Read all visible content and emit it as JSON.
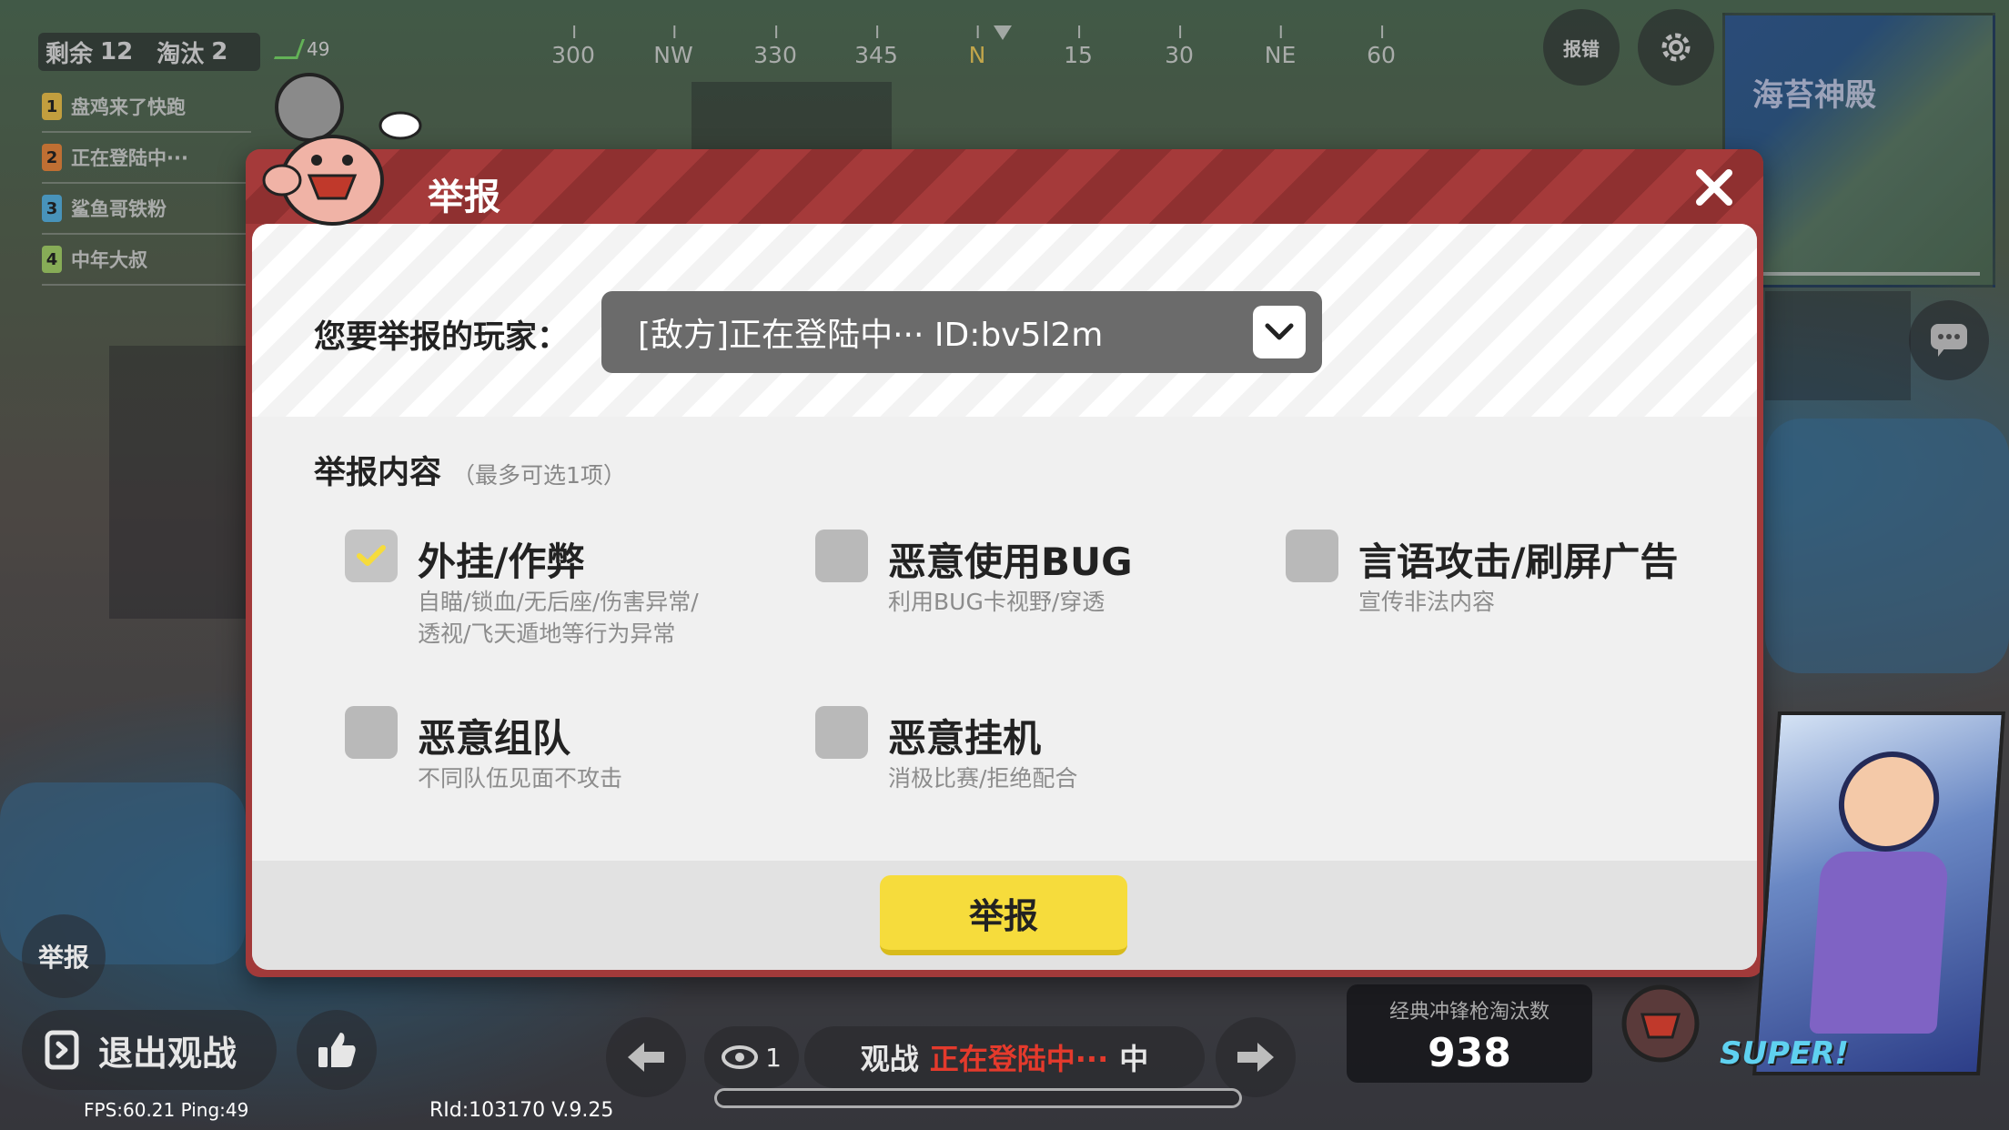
{
  "hud": {
    "remaining_label": "剩余",
    "remaining_value": "12",
    "eliminated_label": "淘汰",
    "eliminated_value": "2",
    "ping_value": "49",
    "players": [
      {
        "num": "1",
        "name": "盘鸡来了快跑",
        "color": "#f4c64a"
      },
      {
        "num": "2",
        "name": "正在登陆中···",
        "color": "#f08a3c"
      },
      {
        "num": "3",
        "name": "鲨鱼哥铁粉",
        "color": "#58b8e8"
      },
      {
        "num": "4",
        "name": "中年大叔",
        "color": "#a8d86a"
      }
    ],
    "compass": [
      "300",
      "NW",
      "330",
      "345",
      "N",
      "15",
      "30",
      "NE",
      "60"
    ],
    "bug_report_label": "报错",
    "minimap_label": "海苔神殿"
  },
  "dialog": {
    "title": "举报",
    "player_label": "您要举报的玩家：",
    "selected_player": "[敌方]正在登陆中··· ID:bv5l2m",
    "content_title": "举报内容",
    "content_note": "（最多可选1项）",
    "options": [
      {
        "label": "外挂/作弊",
        "desc1": "自瞄/锁血/无后座/伤害异常/",
        "desc2": "透视/飞天遁地等行为异常",
        "checked": true
      },
      {
        "label": "恶意使用BUG",
        "desc1": "利用BUG卡视野/穿透",
        "desc2": "",
        "checked": false
      },
      {
        "label": "言语攻击/刷屏广告",
        "desc1": "宣传非法内容",
        "desc2": "",
        "checked": false
      },
      {
        "label": "恶意组队",
        "desc1": "不同队伍见面不攻击",
        "desc2": "",
        "checked": false
      },
      {
        "label": "恶意挂机",
        "desc1": "消极比赛/拒绝配合",
        "desc2": "",
        "checked": false
      }
    ],
    "submit_label": "举报",
    "accent_color": "#f6dc3c",
    "header_color": "#a23a3a"
  },
  "bottom": {
    "report_label": "举报",
    "exit_label": "退出观战",
    "fps_text": "FPS:60.21 Ping:49",
    "rid_text": "RId:103170 V.9.25",
    "viewer_count": "1",
    "spectate_prefix": "观战",
    "spectate_name": "正在登陆中···",
    "spectate_suffix": "中",
    "kills_label": "经典冲锋枪淘汰数",
    "kills_value": "938",
    "super_badge": "SUPER!"
  }
}
